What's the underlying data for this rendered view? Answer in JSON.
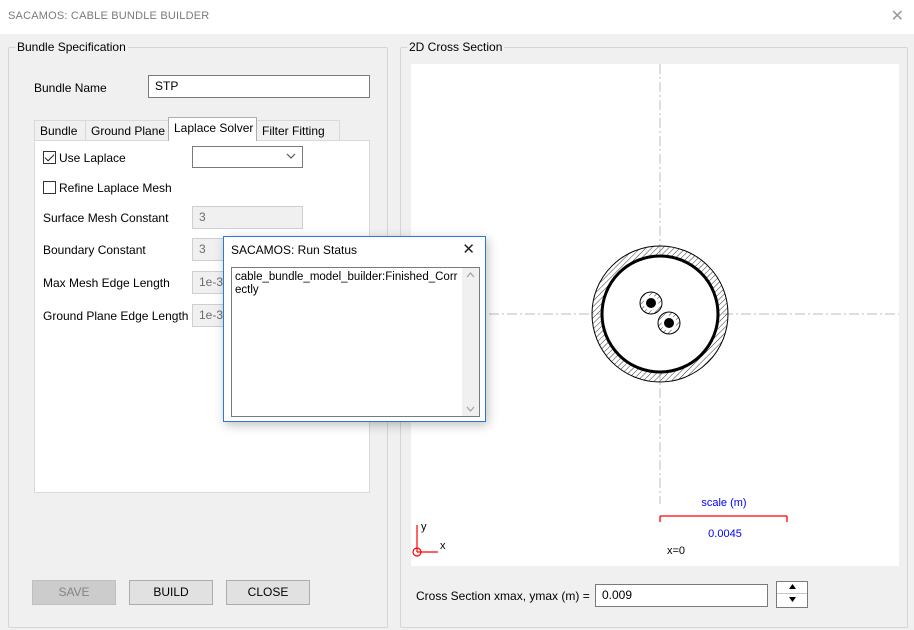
{
  "window": {
    "title": "SACAMOS: CABLE BUNDLE BUILDER",
    "close_glyph": "✕"
  },
  "bundle_spec": {
    "group_title": "Bundle Specification",
    "bundle_name_label": "Bundle Name",
    "bundle_name_value": "STP",
    "tabs": [
      {
        "label": "Bundle",
        "active": false
      },
      {
        "label": "Ground Plane",
        "active": false
      },
      {
        "label": "Laplace Solver",
        "active": true
      },
      {
        "label": "Filter Fitting",
        "active": false
      }
    ],
    "laplace": {
      "use_laplace_label": "Use Laplace",
      "use_laplace_checked": true,
      "solver_combo_value": "",
      "refine_mesh_label": "Refine Laplace Mesh",
      "refine_mesh_checked": false,
      "surface_mesh_constant_label": "Surface Mesh Constant",
      "surface_mesh_constant_value": "3",
      "boundary_constant_label": "Boundary Constant",
      "boundary_constant_value": "3",
      "max_mesh_edge_label": "Max Mesh Edge Length",
      "max_mesh_edge_value": "1e-3",
      "ground_plane_edge_label": "Ground Plane Edge Length",
      "ground_plane_edge_value": "1e-3"
    },
    "buttons": {
      "save": "SAVE",
      "build": "BUILD",
      "close": "CLOSE"
    }
  },
  "cross_section": {
    "group_title": "2D Cross Section",
    "axis_y": "y",
    "axis_x": "x",
    "scale_title": "scale (m)",
    "scale_value": "0.0045",
    "origin_label": "x=0",
    "xmax_label": "Cross Section xmax, ymax (m) =",
    "xmax_value": "0.009",
    "colors": {
      "axis": "#ff0000",
      "scale_text": "#0000ff",
      "scale_bar": "#ff0000",
      "centerline": "#bdbdbd"
    }
  },
  "run_status": {
    "title": "SACAMOS: Run Status",
    "close_glyph": "✕",
    "message": "cable_bundle_model_builder:Finished_Correctly"
  },
  "icons": {
    "close": "close-icon",
    "checkmark": "check-icon",
    "dropdown": "chevron-down-icon",
    "spin_up": "triangle-up-icon",
    "spin_down": "triangle-down-icon"
  }
}
